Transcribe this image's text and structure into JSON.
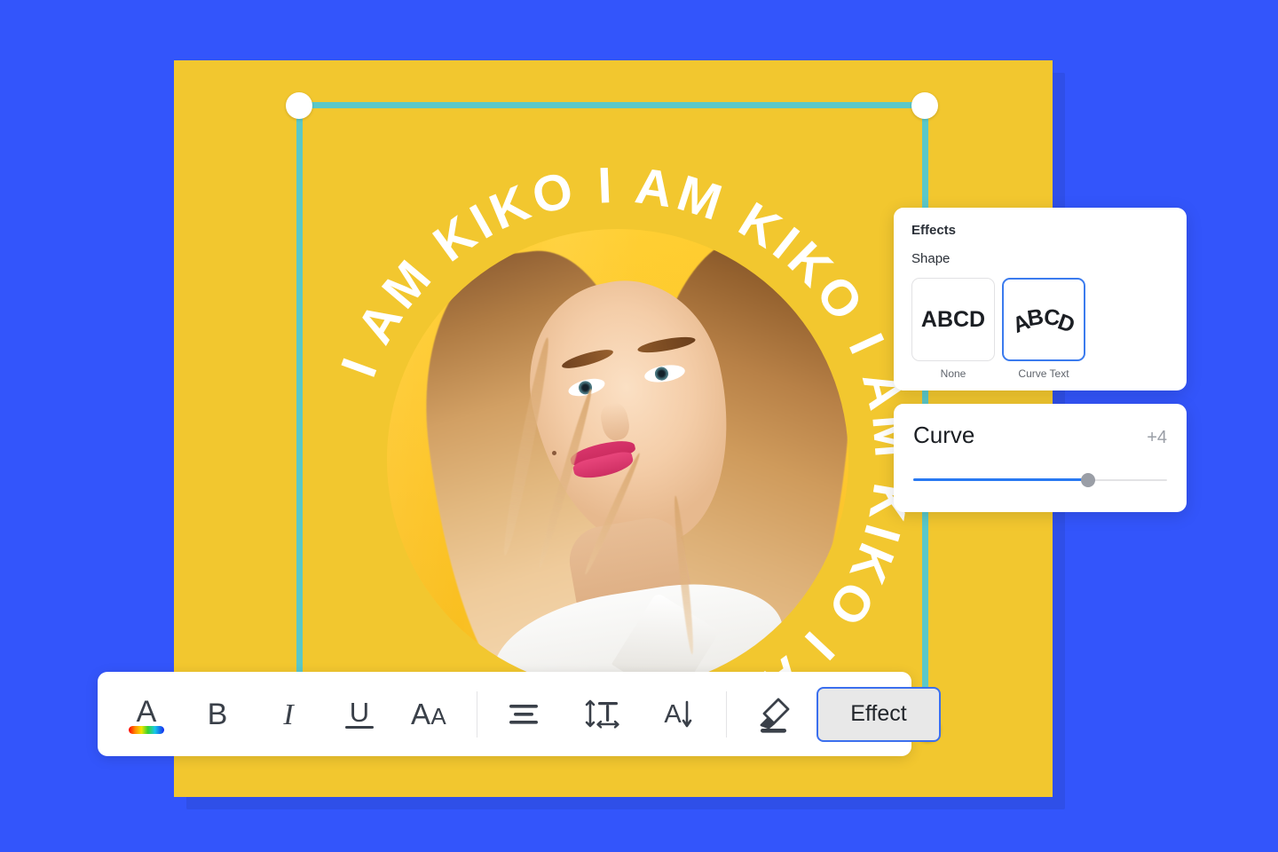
{
  "canvas": {
    "background_color": "#3355FB",
    "card_color": "#F2C72F",
    "guide_color": "#5BC8C8",
    "curved_text": "I AM KIKO I AM KIKO I AM KIKO I AM KIKO ",
    "photo_alt": "woman-portrait-photo"
  },
  "toolbar": {
    "items": [
      {
        "name": "text-color",
        "label": "A"
      },
      {
        "name": "bold",
        "label": "B"
      },
      {
        "name": "italic",
        "label": "I"
      },
      {
        "name": "underline",
        "label": "U"
      },
      {
        "name": "font-case",
        "label": "AA"
      },
      {
        "name": "align",
        "label": "align"
      },
      {
        "name": "line-spacing",
        "label": "line-spacing"
      },
      {
        "name": "text-direction",
        "label": "text-direction"
      },
      {
        "name": "highlighter",
        "label": "highlighter"
      }
    ],
    "effect_label": "Effect",
    "effect_selected": true,
    "effect_border_color": "#3B6FEE",
    "effect_fill_color": "#E8E8E8"
  },
  "effects_panel": {
    "title": "Effects",
    "shape_label": "Shape",
    "options": [
      {
        "caption": "None",
        "preview": "ABCD",
        "selected": false
      },
      {
        "caption": "Curve Text",
        "preview": "ABCD",
        "selected": true
      }
    ],
    "selected_border_color": "#3B7BEE"
  },
  "curve_panel": {
    "title": "Curve",
    "value": "+4",
    "percent": 69,
    "fill_color": "#2979F2",
    "track_color": "#E3E3E5",
    "handle_color": "#9A9EA6"
  }
}
